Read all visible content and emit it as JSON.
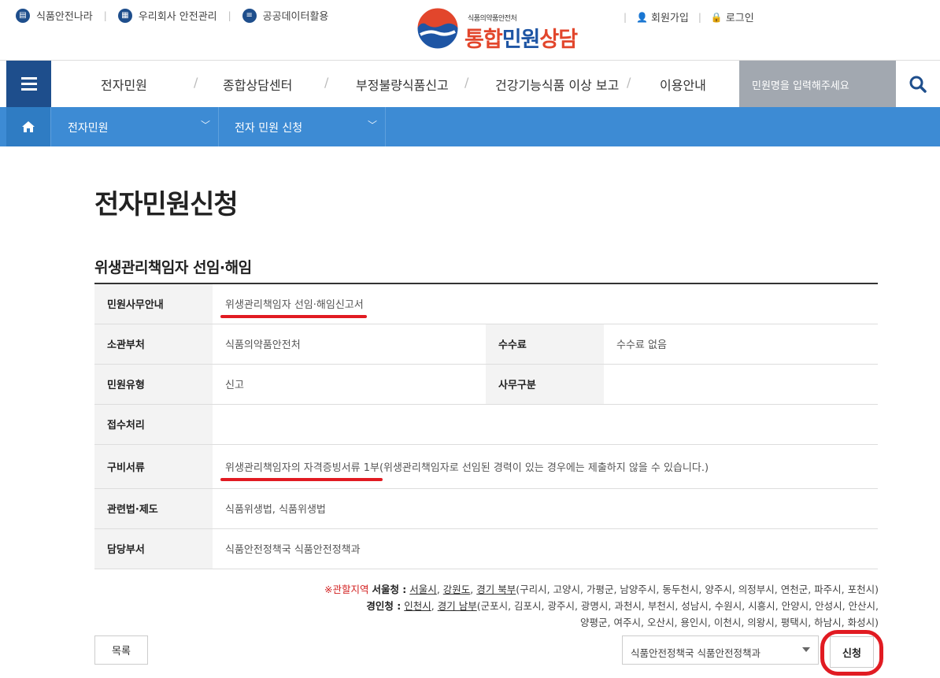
{
  "utility": {
    "left_links": [
      "식품안전나라",
      "우리회사 안전관리",
      "공공데이터활용"
    ],
    "right_links": [
      "회원가입",
      "로그인"
    ]
  },
  "logo": {
    "org": "식품의약품안전처",
    "title_a": "통합",
    "title_b": "민원",
    "title_c": "상담"
  },
  "gnb": {
    "items": [
      "전자민원",
      "종합상담센터",
      "부정불량식품신고",
      "건강기능식품 이상 보고",
      "이용안내"
    ],
    "search_placeholder": "민원명을 입력해주세요"
  },
  "subnav": {
    "level1": "전자민원",
    "level2": "전자 민원 신청"
  },
  "page_title": "전자민원신청",
  "section_title": "위생관리책임자 선임·해임",
  "info": {
    "guide_label": "민원사무안내",
    "guide_value": "위생관리책임자 선임·해임신고서",
    "dept_label": "소관부처",
    "dept_value": "식품의약품안전처",
    "fee_label": "수수료",
    "fee_value": "수수료 없음",
    "type_label": "민원유형",
    "type_value": "신고",
    "work_label": "사무구분",
    "work_value": "",
    "receipt_label": "접수처리",
    "receipt_value": "",
    "docs_label": "구비서류",
    "docs_value_a": "위생관리책임자의 자격증빙서류 1부",
    "docs_value_b": "(위생관리책임자로 선임된 경력이 있는 경우에는 제출하지 않을 수 있습니다.)",
    "law_label": "관련법·제도",
    "law_value": "식품위생법, 식품위생법",
    "charge_label": "담당부서",
    "charge_value": "식품안전정책국 식품안전정책과"
  },
  "region": {
    "warn": "※관할지역",
    "seoul_label": "서울청 :",
    "seoul_links": [
      "서울시",
      "강원도",
      "경기 북부"
    ],
    "seoul_rest": "(구리시, 고양시, 가평군, 남양주시, 동두천시, 양주시, 의정부시, 연천군, 파주시, 포천시)",
    "incheon_label": "경인청 :",
    "incheon_links": [
      "인천시",
      "경기 남부"
    ],
    "incheon_rest_1": "(군포시, 김포시, 광주시, 광명시, 과천시, 부천시, 성남시, 수원시, 시흥시, 안양시, 안성시, 안산시,",
    "incheon_rest_2": "양평군, 여주시, 오산시, 용인시, 이천시, 의왕시, 평택시, 하남시, 화성시)"
  },
  "actions": {
    "list_label": "목록",
    "dept_selected": "식품안전정책국 식품안전정책과",
    "apply_label": "신청"
  },
  "colors": {
    "primary": "#1e4e8c",
    "subnav": "#3d8bd4",
    "highlight": "#e11b22"
  }
}
